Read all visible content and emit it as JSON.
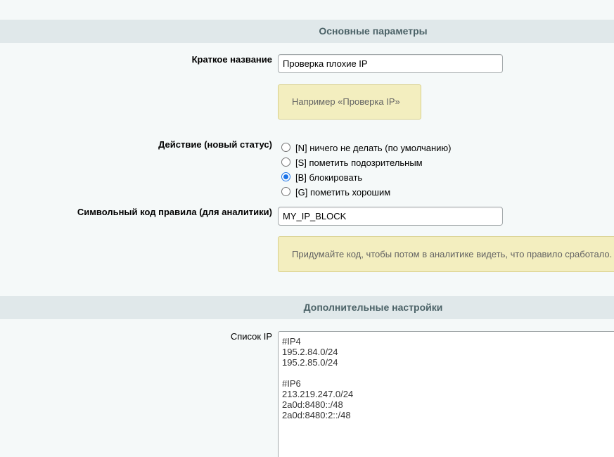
{
  "sections": {
    "main": {
      "title": "Основные параметры"
    },
    "extra": {
      "title": "Дополнительные настройки"
    }
  },
  "fields": {
    "short_name": {
      "label": "Краткое название",
      "value": "Проверка плохие IP",
      "hint": "Например «Проверка IP»"
    },
    "action": {
      "label": "Действие (новый статус)",
      "options": [
        {
          "label": "[N] ничего не делать (по умолчанию)",
          "checked": false
        },
        {
          "label": "[S] пометить подозрительным",
          "checked": false
        },
        {
          "label": "[B] блокировать",
          "checked": true
        },
        {
          "label": "[G] пометить хорошим",
          "checked": false
        }
      ],
      "selected": "[B] блокировать"
    },
    "rule_code": {
      "label": "Символьный код правила (для аналитики)",
      "value": "MY_IP_BLOCK",
      "hint": "Придумайте код, чтобы потом в аналитике видеть, что правило сработало."
    },
    "ip_list": {
      "label": "Список IP",
      "lines": [
        "#IP4",
        "195.2.84.0/24",
        "195.2.85.0/24",
        "",
        "#IP6",
        "213.219.247.0/24",
        "2a0d:8480::/48",
        "2a0d:8480:2::/48"
      ]
    }
  },
  "colors": {
    "background": "#f5f9f9",
    "section_header_bg": "#e0e8ea",
    "section_header_text": "#4b6267",
    "hint_bg": "#f3eebf",
    "hint_border": "#d9d08c",
    "radio_accent": "#1a73e8"
  }
}
